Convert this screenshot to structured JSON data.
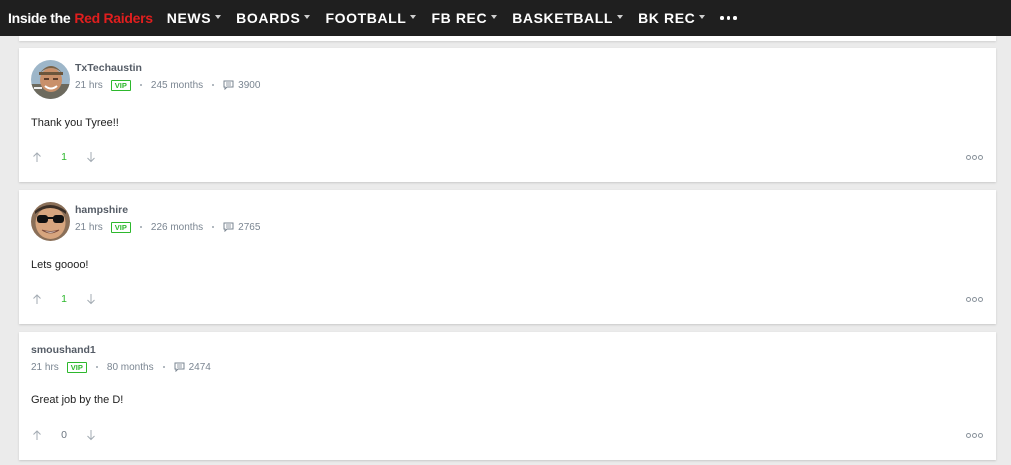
{
  "nav": {
    "brand_part1": "Inside the",
    "brand_part2": "Red Raiders",
    "items": [
      {
        "label": "NEWS"
      },
      {
        "label": "BOARDS"
      },
      {
        "label": "FOOTBALL"
      },
      {
        "label": "FB REC"
      },
      {
        "label": "BASKETBALL"
      },
      {
        "label": "BK REC"
      }
    ],
    "more_icon": "ellipsis-icon"
  },
  "posts": [
    {
      "username": "TxTechaustin",
      "time": "21 hrs",
      "badge": "VIP",
      "tenure": "245 months",
      "message_count": "3900",
      "body": "Thank you Tyree!!",
      "score": "1",
      "score_color": "#2db82d",
      "avatar": "user-avatar-photo"
    },
    {
      "username": "hampshire",
      "time": "21 hrs",
      "badge": "VIP",
      "tenure": "226 months",
      "message_count": "2765",
      "body": "Lets goooo!",
      "score": "1",
      "score_color": "#2db82d",
      "avatar": "user-avatar-photo"
    },
    {
      "username": "smoushand1",
      "time": "21 hrs",
      "badge": "VIP",
      "tenure": "80 months",
      "message_count": "2474",
      "body": "Great job by the D!",
      "score": "0",
      "score_color": "#6b7580"
    }
  ],
  "colors": {
    "nav_bg": "#1f1f1f",
    "brand_red": "#e01e1e",
    "vip_green": "#2db82d",
    "page_bg": "#ebebeb"
  }
}
